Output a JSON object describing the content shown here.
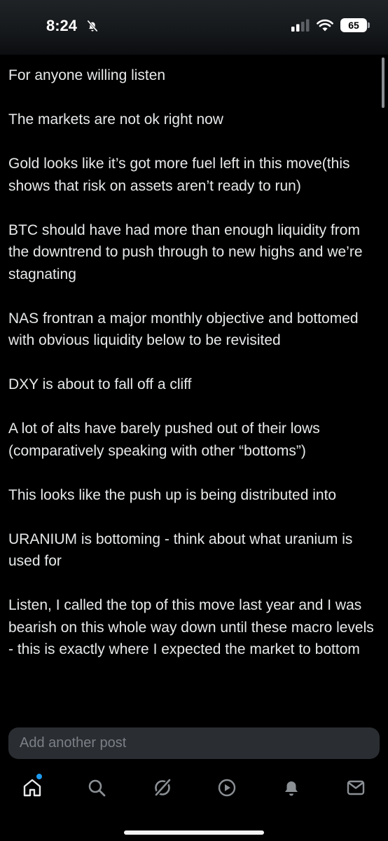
{
  "status_bar": {
    "time": "8:24",
    "battery": "65",
    "icons": [
      "bell-slash-icon",
      "signal-icon",
      "wifi-icon",
      "battery-icon"
    ]
  },
  "post": {
    "paragraphs": [
      "For anyone willing listen",
      "The markets are not ok right now",
      "Gold looks like it’s got more fuel left in this move(this shows that risk on assets aren’t ready to run)",
      "BTC should have had more than enough liquidity from the downtrend to push through to new highs and we’re stagnating",
      "NAS frontran a major monthly objective and bottomed with obvious liquidity below to be revisited",
      "DXY is about to fall off a cliff",
      "A lot of alts have barely pushed out of their lows  (comparatively speaking with other “bottoms”)",
      "This looks like the push up is being distributed into",
      "URANIUM is bottoming - think about what uranium is used for",
      "Listen, I called the top of this move last year and I was bearish on this whole way down until these macro levels - this is exactly where I expected the market to bottom"
    ]
  },
  "composer": {
    "placeholder": "Add another post"
  },
  "tab_bar": {
    "items": [
      "home-icon",
      "search-icon",
      "grok-icon",
      "video-icon",
      "notifications-icon",
      "messages-icon"
    ]
  },
  "colors": {
    "background": "#000000",
    "text": "#e7e9ea",
    "input_bg": "#2a2d31",
    "placeholder": "#7b8087",
    "accent": "#1d9bf0"
  }
}
